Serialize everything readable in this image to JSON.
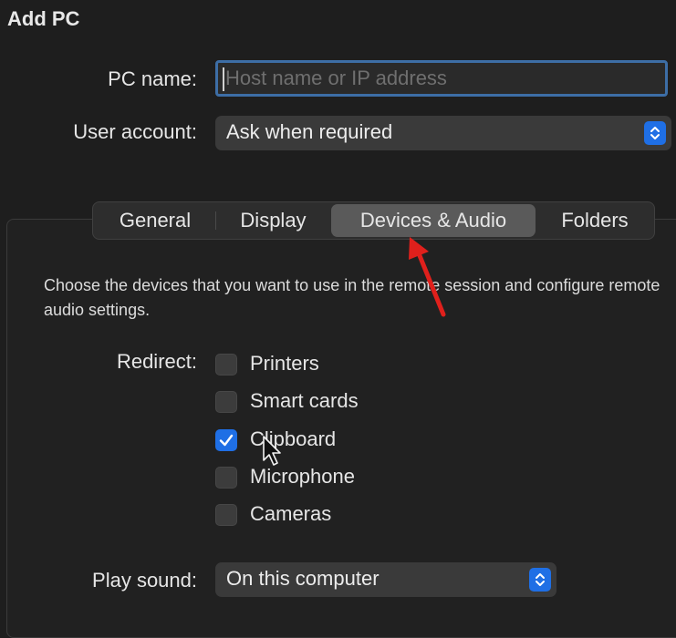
{
  "window": {
    "title": "Add PC"
  },
  "pc_name": {
    "label": "PC name:",
    "placeholder": "Host name or IP address",
    "value": ""
  },
  "user_account": {
    "label": "User account:",
    "selected": "Ask when required"
  },
  "tabs": [
    {
      "label": "General",
      "selected": false
    },
    {
      "label": "Display",
      "selected": false
    },
    {
      "label": "Devices & Audio",
      "selected": true
    },
    {
      "label": "Folders",
      "selected": false
    }
  ],
  "devices": {
    "description": "Choose the devices that you want to use in the remote session and configure remote audio settings.",
    "redirect_label": "Redirect:",
    "options": [
      {
        "label": "Printers",
        "checked": false
      },
      {
        "label": "Smart cards",
        "checked": false
      },
      {
        "label": "Clipboard",
        "checked": true
      },
      {
        "label": "Microphone",
        "checked": false
      },
      {
        "label": "Cameras",
        "checked": false
      }
    ],
    "play_sound": {
      "label": "Play sound:",
      "selected": "On this computer"
    }
  },
  "colors": {
    "accent": "#1f6fe5",
    "annotation_arrow": "#e0201c",
    "background": "#1e1e1e"
  }
}
